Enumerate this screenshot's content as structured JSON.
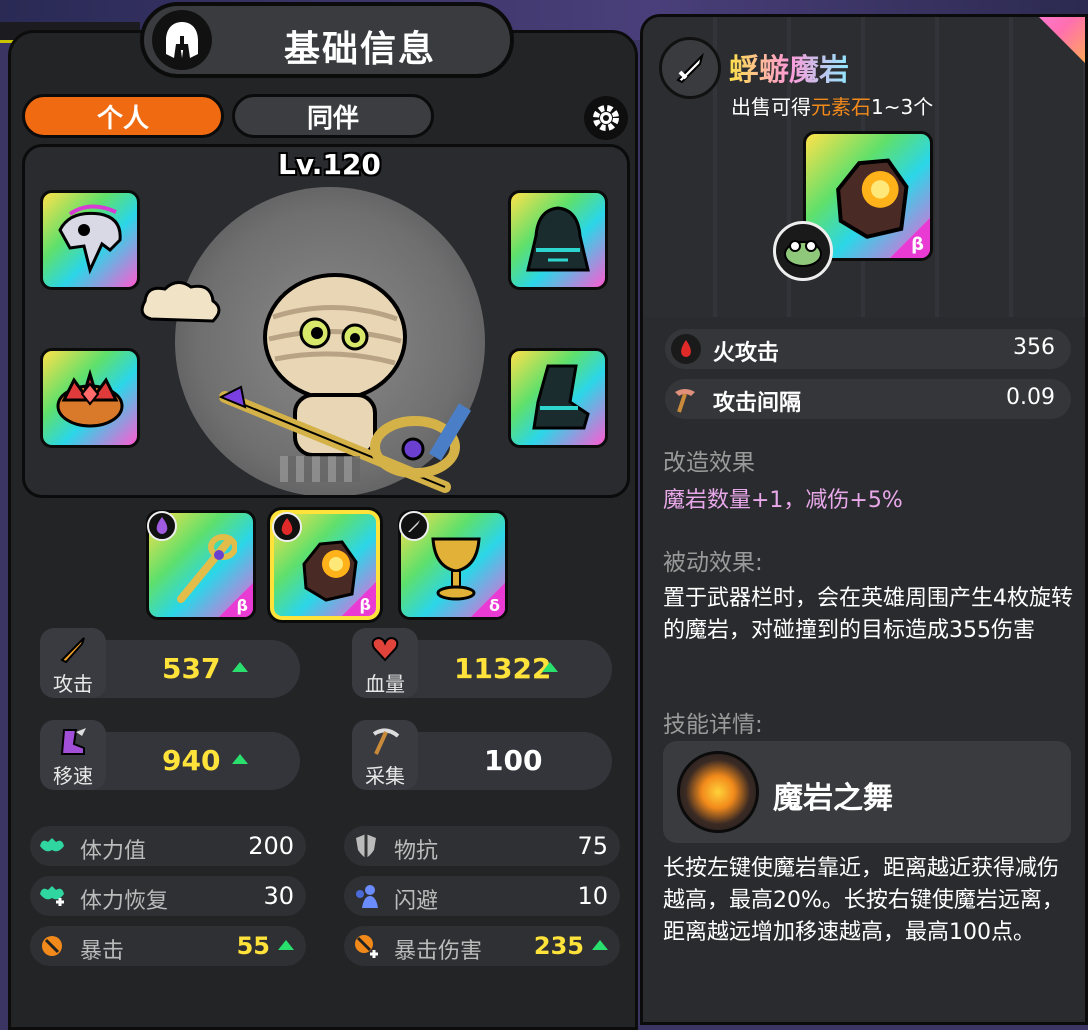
{
  "header": {
    "title": "基础信息"
  },
  "tabs": [
    {
      "label": "个人",
      "active": true
    },
    {
      "label": "同伴",
      "active": false
    }
  ],
  "hero": {
    "level": "Lv.120"
  },
  "weapons": [
    {
      "element": "purple-drop",
      "rank": "β"
    },
    {
      "element": "fire-drop",
      "rank": "β",
      "selected": true
    },
    {
      "element": "sword",
      "rank": "δ"
    }
  ],
  "stats_main": [
    {
      "label": "攻击",
      "value": "537",
      "up": true,
      "color": "#ffe23a"
    },
    {
      "label": "血量",
      "value": "11322",
      "up": true,
      "color": "#ffe23a"
    },
    {
      "label": "移速",
      "value": "940",
      "up": true,
      "color": "#ffe23a"
    },
    {
      "label": "采集",
      "value": "100",
      "up": false,
      "color": "#ffffff"
    }
  ],
  "stats_sub": [
    {
      "label": "体力值",
      "value": "200"
    },
    {
      "label": "物抗",
      "value": "75"
    },
    {
      "label": "体力恢复",
      "value": "30"
    },
    {
      "label": "闪避",
      "value": "10"
    },
    {
      "label": "暴击",
      "value": "55",
      "highlight": true
    },
    {
      "label": "暴击伤害",
      "value": "235",
      "highlight": true
    }
  ],
  "item": {
    "name": "蜉蝣魔岩",
    "sell_prefix": "出售可得",
    "sell_currency": "元素石",
    "sell_amount": "1~3个",
    "rank": "β",
    "attrs": [
      {
        "label": "火攻击",
        "value": "356"
      },
      {
        "label": "攻击间隔",
        "value": "0.09"
      }
    ],
    "mod_title": "改造效果",
    "mod_text": "魔岩数量+1，减伤+5%",
    "passive_title": "被动效果:",
    "passive_text": "置于武器栏时，会在英雄周围产生4枚旋转的魔岩，对碰撞到的目标造成355伤害",
    "skill_title": "技能详情:",
    "skill_name": "魔岩之舞",
    "skill_text": "长按左键使魔岩靠近，距离越近获得减伤越高，最高20%。长按右键使魔岩远离，距离越远增加移速越高，最高100点。"
  }
}
